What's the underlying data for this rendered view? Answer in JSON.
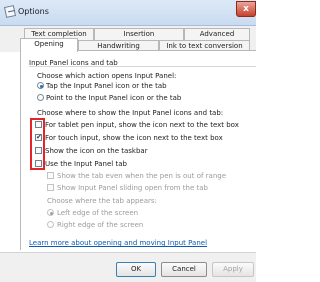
{
  "window": {
    "title": "Options",
    "close_label": "x"
  },
  "tabs": {
    "row1": [
      {
        "label": "Text completion"
      },
      {
        "label": "Insertion"
      },
      {
        "label": "Advanced"
      }
    ],
    "row2": [
      {
        "label": "Opening",
        "active": true
      },
      {
        "label": "Handwriting"
      },
      {
        "label": "Ink to text conversion"
      }
    ]
  },
  "panel": {
    "section_title": "Input Panel icons and tab",
    "open_action_label": "Choose which action opens Input Panel:",
    "open_options": [
      {
        "label": "Tap the Input Panel icon or the tab",
        "checked": true
      },
      {
        "label": "Point to the Input Panel icon or the tab",
        "checked": false
      }
    ],
    "show_where_label": "Choose where to show the Input Panel icons and tab:",
    "show_options": [
      {
        "label": "For tablet pen input, show the icon next to the text box",
        "checked": false
      },
      {
        "label": "For touch input, show the icon next to the text box",
        "checked": true
      },
      {
        "label": "Show the icon on the taskbar",
        "checked": false
      },
      {
        "label": "Use the Input Panel tab",
        "checked": false
      }
    ],
    "tab_options": [
      {
        "label": "Show the tab even when the pen is out of range",
        "checked": false
      },
      {
        "label": "Show Input Panel sliding open from the tab",
        "checked": false
      }
    ],
    "tab_appears_label": "Choose where the tab appears:",
    "tab_positions": [
      {
        "label": "Left edge of the screen",
        "checked": true
      },
      {
        "label": "Right edge of the screen",
        "checked": false
      }
    ],
    "learn_more_link": "Learn more about opening and moving Input Panel"
  },
  "buttons": {
    "ok": "OK",
    "cancel": "Cancel",
    "apply": "Apply"
  },
  "colors": {
    "highlight": "#e1252a",
    "link": "#0e5bb5",
    "titlebar": "#d6e5f6"
  }
}
